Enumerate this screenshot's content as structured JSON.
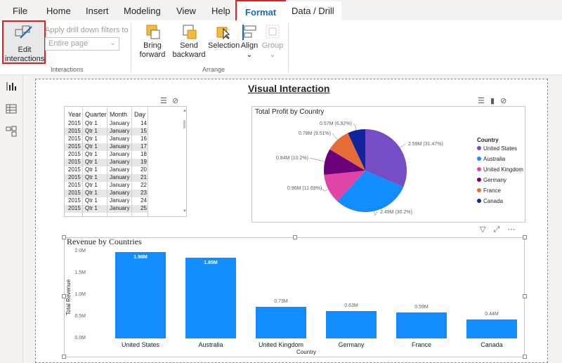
{
  "menu": {
    "tabs": [
      "File",
      "Home",
      "Insert",
      "Modeling",
      "View",
      "Help",
      "Format",
      "Data / Drill"
    ]
  },
  "ribbon": {
    "edit_interactions": "Edit interactions",
    "drill_filters_label": "Apply drill down filters to",
    "drill_filters_value": "Entire page",
    "group_interactions": "Interactions",
    "bring_forward": "Bring forward",
    "send_backward": "Send backward",
    "selection": "Selection",
    "align": "Align",
    "group": "Group",
    "group_arrange": "Arrange"
  },
  "report": {
    "title": "Visual Interaction"
  },
  "table": {
    "columns": [
      "Year",
      "Quarter",
      "Month",
      "Day"
    ],
    "rows": [
      [
        "2015",
        "Qtr 1",
        "January",
        "14"
      ],
      [
        "2015",
        "Qtr 1",
        "January",
        "15"
      ],
      [
        "2015",
        "Qtr 1",
        "January",
        "16"
      ],
      [
        "2015",
        "Qtr 1",
        "January",
        "17"
      ],
      [
        "2015",
        "Qtr 1",
        "January",
        "18"
      ],
      [
        "2015",
        "Qtr 1",
        "January",
        "19"
      ],
      [
        "2015",
        "Qtr 1",
        "January",
        "20"
      ],
      [
        "2015",
        "Qtr 1",
        "January",
        "21"
      ],
      [
        "2015",
        "Qtr 1",
        "January",
        "22"
      ],
      [
        "2015",
        "Qtr 1",
        "January",
        "23"
      ],
      [
        "2015",
        "Qtr 1",
        "January",
        "24"
      ],
      [
        "2015",
        "Qtr 1",
        "January",
        "25"
      ]
    ]
  },
  "chart_data": [
    {
      "type": "pie",
      "title": "Total Profit by Country",
      "legend_title": "Country",
      "legend_position": "right",
      "slices": [
        {
          "label": "United States",
          "value": 2.59,
          "display": "2.59M (31.47%)",
          "color": "#744ec2"
        },
        {
          "label": "Australia",
          "value": 2.49,
          "display": "2.49M (30.2%)",
          "color": "#118dff"
        },
        {
          "label": "United Kingdom",
          "value": 0.96,
          "display": "0.96M (11.69%)",
          "color": "#e044a7"
        },
        {
          "label": "Germany",
          "value": 0.84,
          "display": "0.84M (10.2%)",
          "color": "#6b007b"
        },
        {
          "label": "France",
          "value": 0.78,
          "display": "0.78M (9.51%)",
          "color": "#e66c37"
        },
        {
          "label": "Canada",
          "value": 0.57,
          "display": "0.57M (6.92%)",
          "color": "#12239e"
        }
      ]
    },
    {
      "type": "bar",
      "title": "Revenue by Countries",
      "xlabel": "Country",
      "ylabel": "Total Revenue",
      "ylim": [
        0,
        2.0
      ],
      "yticks": [
        "0.0M",
        "0.5M",
        "1.0M",
        "1.5M",
        "2.0M"
      ],
      "categories": [
        "United States",
        "Australia",
        "United Kingdom",
        "Germany",
        "France",
        "Canada"
      ],
      "values": [
        1.98,
        1.85,
        0.73,
        0.63,
        0.59,
        0.44
      ],
      "value_labels": [
        "1.98M",
        "1.85M",
        "0.73M",
        "0.63M",
        "0.59M",
        "0.44M"
      ],
      "color": "#118dff",
      "grid": false
    }
  ]
}
